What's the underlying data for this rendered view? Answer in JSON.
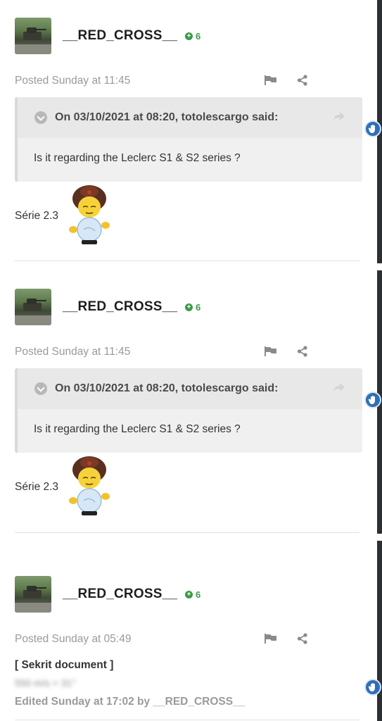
{
  "posts": [
    {
      "author": "__RED_CROSS__",
      "reputation": "6",
      "posted": "Posted Sunday at 11:45",
      "quote": {
        "header": "On 03/10/2021 at 08:20, totolescargo said:",
        "body": "Is it regarding the Leclerc S1 & S2 series ?"
      },
      "text": "Série 2.3"
    },
    {
      "author": "__RED_CROSS__",
      "reputation": "6",
      "posted": "Posted Sunday at 11:45",
      "quote": {
        "header": "On 03/10/2021 at 08:20, totolescargo said:",
        "body": "Is it regarding the Leclerc S1 & S2 series ?"
      },
      "text": "Série 2.3"
    },
    {
      "author": "__RED_CROSS__",
      "reputation": "6",
      "posted": "Posted Sunday at 05:49",
      "doc_title": "[ Sekrit document ]",
      "redacted": "550 m/s = 31°",
      "edited": "Edited Sunday at 17:02 by __RED_CROSS__"
    }
  ],
  "icons": {
    "flag": "flag-icon",
    "share": "share-icon",
    "reply": "reply-arrow-icon",
    "fab": "hand-icon"
  },
  "colors": {
    "reputation_green": "#3c9a4a",
    "fab_blue": "#2f6fb6"
  }
}
